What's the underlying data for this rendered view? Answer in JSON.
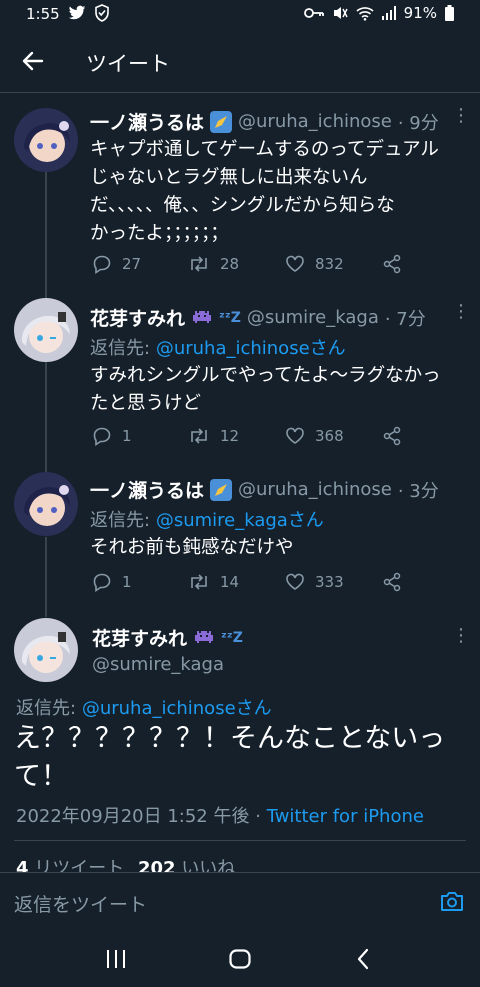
{
  "status": {
    "time": "1:55",
    "battery": "91%"
  },
  "header": {
    "title": "ツイート"
  },
  "tweets": [
    {
      "name": "一ノ瀬うるは",
      "handle": "@uruha_ichinose",
      "time": "· 9分",
      "text_lines": [
        "キャプボ通してゲームするのってデュアル",
        "じゃないとラグ無しに出来ないん",
        "だ、、、、、俺、、シングルだから知らな",
        "かったよ；；；；；；"
      ],
      "replies": "27",
      "retweets": "28",
      "likes": "832"
    },
    {
      "name": "花芽すみれ",
      "handle": "@sumire_kaga",
      "time": "· 7分",
      "reply_label": "返信先:",
      "reply_to": "@uruha_ichinoseさん",
      "text_lines": [
        "すみれシングルでやってたよ～ラグなかっ",
        "たと思うけど"
      ],
      "replies": "1",
      "retweets": "12",
      "likes": "368"
    },
    {
      "name": "一ノ瀬うるは",
      "handle": "@uruha_ichinose",
      "time": "· 3分",
      "reply_label": "返信先:",
      "reply_to": "@sumire_kagaさん",
      "text_lines": [
        "それお前も鈍感なだけや"
      ],
      "replies": "1",
      "retweets": "14",
      "likes": "333"
    }
  ],
  "main_tweet": {
    "name": "花芽すみれ",
    "handle": "@sumire_kaga",
    "reply_label": "返信先:",
    "reply_to": "@uruha_ichinoseさん",
    "text_lines": [
      "え？？？？？？！そんなことないっ",
      "て！"
    ],
    "date": "2022年09月20日 1:52 午後 ·",
    "client": "Twitter for iPhone",
    "retweet_count": "4",
    "retweet_label": "リツイート",
    "like_count": "202",
    "like_label": "いいね"
  },
  "composer": {
    "placeholder": "返信をツイート"
  },
  "colors": {
    "background": "#15202b",
    "link": "#1d9bf0",
    "muted": "#8899a6",
    "divider": "#38444d"
  }
}
